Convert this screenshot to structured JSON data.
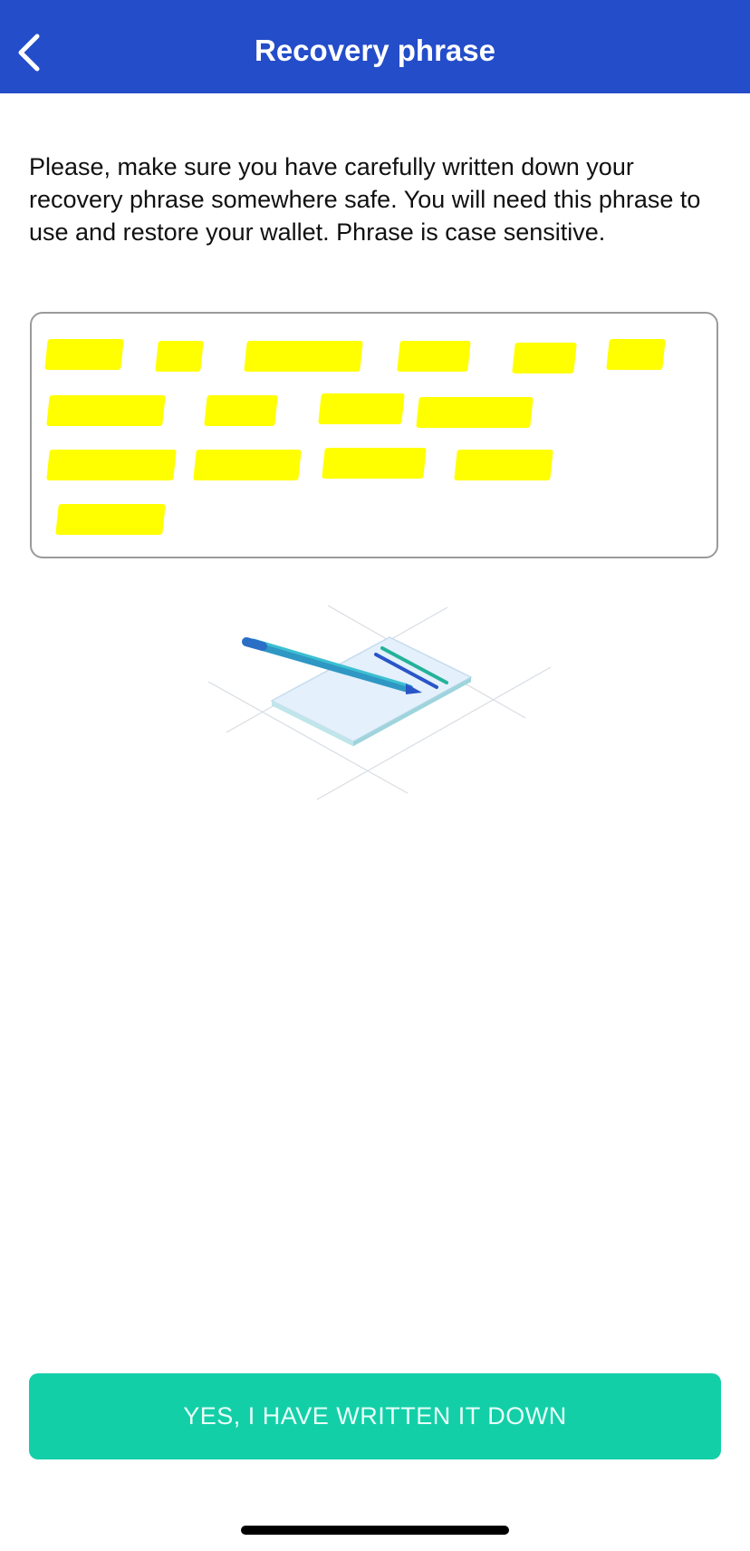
{
  "header": {
    "title": "Recovery phrase",
    "back_icon": "chevron-left-icon",
    "background_color": "#244dc9"
  },
  "instructions": {
    "text": "Please, make sure you have carefully written down your recovery phrase somewhere safe. You will need this phrase to use and restore your wallet. Phrase is case sensitive."
  },
  "phrase": {
    "words": [
      {
        "label": "",
        "redacted": true
      },
      {
        "label": "",
        "redacted": true
      },
      {
        "label": "",
        "redacted": true
      },
      {
        "label": "",
        "redacted": true
      },
      {
        "label": "",
        "redacted": true
      },
      {
        "label": "",
        "redacted": true
      },
      {
        "label": "",
        "redacted": true
      },
      {
        "label": "",
        "redacted": true
      },
      {
        "label": "",
        "redacted": true
      },
      {
        "label": "",
        "redacted": true
      },
      {
        "label": "",
        "redacted": true
      },
      {
        "label": "",
        "redacted": true
      },
      {
        "label": "",
        "redacted": true
      },
      {
        "label": "",
        "redacted": true
      },
      {
        "label": "",
        "redacted": true
      }
    ],
    "redaction_color": "#ffff00"
  },
  "illustration": {
    "icon": "notepad-pen-icon"
  },
  "confirm_button": {
    "label": "YES, I HAVE WRITTEN IT DOWN",
    "color": "#13cfa8"
  }
}
